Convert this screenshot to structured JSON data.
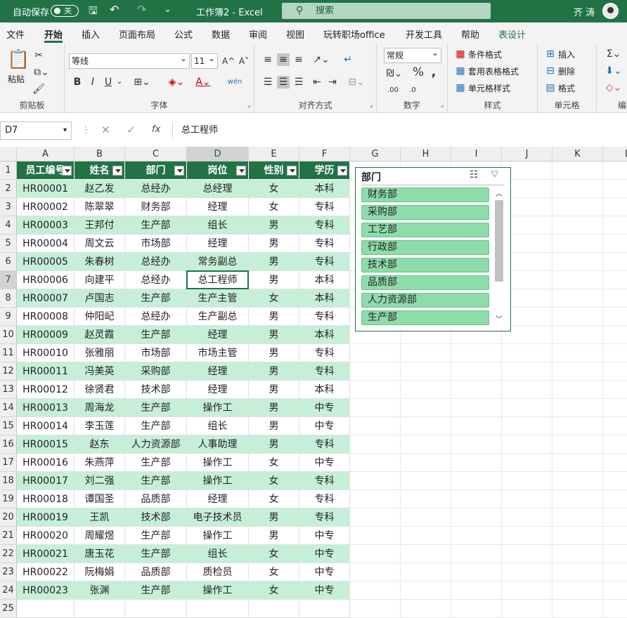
{
  "titlebar": {
    "autosave_label": "自动保存",
    "autosave_state": "关",
    "title": "工作簿2  -  Excel",
    "search_placeholder": "搜索",
    "user_name": "齐 涛"
  },
  "tabs": [
    "文件",
    "开始",
    "插入",
    "页面布局",
    "公式",
    "数据",
    "审阅",
    "视图",
    "玩转职场office",
    "开发工具",
    "帮助",
    "表设计"
  ],
  "active_tab": "开始",
  "ribbon": {
    "clipboard": {
      "paste": "粘贴",
      "label": "剪贴板"
    },
    "font": {
      "name": "等线",
      "size": "11",
      "label": "字体",
      "grow": "A^",
      "shrink": "A˅",
      "bold": "B",
      "italic": "I",
      "underline": "U",
      "phonetic": "wén"
    },
    "alignment": {
      "label": "对齐方式"
    },
    "number": {
      "format": "常规",
      "label": "数字"
    },
    "styles": {
      "conditional": "条件格式",
      "table": "套用表格格式",
      "cell": "单元格样式",
      "label": "样式"
    },
    "cells": {
      "insert": "插入",
      "delete": "删除",
      "format": "格式",
      "label": "单元格"
    },
    "editing": {
      "label": "编"
    }
  },
  "formula_bar": {
    "name_box": "D7",
    "formula": "总工程师",
    "fx": "fx"
  },
  "grid": {
    "columns": [
      "A",
      "B",
      "C",
      "D",
      "E",
      "F",
      "G",
      "H",
      "I",
      "J",
      "K",
      "L"
    ],
    "selected_col": "D",
    "selected_row": 7,
    "headers": [
      "员工编号",
      "姓名",
      "部门",
      "岗位",
      "性别",
      "学历"
    ],
    "rows": [
      [
        "HR00001",
        "赵乙发",
        "总经办",
        "总经理",
        "女",
        "本科"
      ],
      [
        "HR00002",
        "陈翠翠",
        "财务部",
        "经理",
        "女",
        "专科"
      ],
      [
        "HR00003",
        "王邦付",
        "生产部",
        "组长",
        "男",
        "专科"
      ],
      [
        "HR00004",
        "周文云",
        "市场部",
        "经理",
        "男",
        "专科"
      ],
      [
        "HR00005",
        "朱春树",
        "总经办",
        "常务副总",
        "男",
        "专科"
      ],
      [
        "HR00006",
        "向建平",
        "总经办",
        "总工程师",
        "男",
        "本科"
      ],
      [
        "HR00007",
        "卢国志",
        "生产部",
        "生产主管",
        "女",
        "本科"
      ],
      [
        "HR00008",
        "仲阳屺",
        "总经办",
        "生产副总",
        "男",
        "专科"
      ],
      [
        "HR00009",
        "赵灵霞",
        "生产部",
        "经理",
        "男",
        "本科"
      ],
      [
        "HR00010",
        "张雅丽",
        "市场部",
        "市场主管",
        "男",
        "专科"
      ],
      [
        "HR00011",
        "冯美英",
        "采购部",
        "经理",
        "男",
        "专科"
      ],
      [
        "HR00012",
        "徐贤君",
        "技术部",
        "经理",
        "男",
        "本科"
      ],
      [
        "HR00013",
        "周海龙",
        "生产部",
        "操作工",
        "男",
        "中专"
      ],
      [
        "HR00014",
        "李玉莲",
        "生产部",
        "组长",
        "男",
        "中专"
      ],
      [
        "HR00015",
        "赵东",
        "人力资源部",
        "人事助理",
        "男",
        "专科"
      ],
      [
        "HR00016",
        "朱燕萍",
        "生产部",
        "操作工",
        "女",
        "中专"
      ],
      [
        "HR00017",
        "刘二强",
        "生产部",
        "操作工",
        "女",
        "专科"
      ],
      [
        "HR00018",
        "谭国圣",
        "品质部",
        "经理",
        "女",
        "专科"
      ],
      [
        "HR00019",
        "王凯",
        "技术部",
        "电子技术员",
        "男",
        "专科"
      ],
      [
        "HR00020",
        "周耀煜",
        "生产部",
        "操作工",
        "男",
        "中专"
      ],
      [
        "HR00021",
        "唐玉花",
        "生产部",
        "组长",
        "女",
        "中专"
      ],
      [
        "HR00022",
        "阮梅娟",
        "品质部",
        "质检员",
        "女",
        "中专"
      ],
      [
        "HR00023",
        "张渊",
        "生产部",
        "操作工",
        "女",
        "中专"
      ]
    ]
  },
  "slicer": {
    "title": "部门",
    "items": [
      "财务部",
      "采购部",
      "工艺部",
      "行政部",
      "技术部",
      "品质部",
      "人力资源部",
      "生产部"
    ]
  }
}
